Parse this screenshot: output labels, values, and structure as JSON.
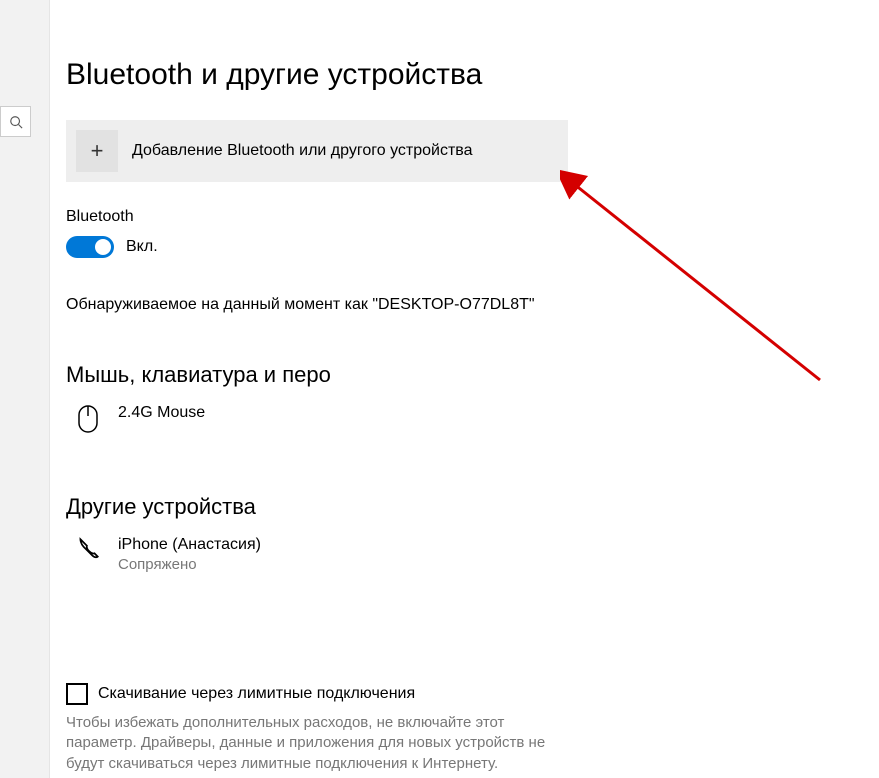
{
  "page": {
    "title": "Bluetooth и другие устройства"
  },
  "addDevice": {
    "label": "Добавление Bluetooth или другого устройства",
    "plus": "+"
  },
  "bluetooth": {
    "label": "Bluetooth",
    "stateText": "Вкл.",
    "discoverableText": "Обнаруживаемое на данный момент как \"DESKTOP-O77DL8T\""
  },
  "sections": {
    "mouseKeyboardPen": "Мышь, клавиатура и перо",
    "otherDevices": "Другие устройства"
  },
  "devices": {
    "mouse": {
      "name": "2.4G Mouse"
    },
    "phone": {
      "name": "iPhone (Анастасия)",
      "status": "Сопряжено"
    }
  },
  "metered": {
    "checkboxLabel": "Скачивание через лимитные подключения",
    "description": "Чтобы избежать дополнительных расходов, не включайте этот параметр. Драйверы, данные и приложения для новых устройств не будут скачиваться через лимитные подключения к Интернету."
  }
}
